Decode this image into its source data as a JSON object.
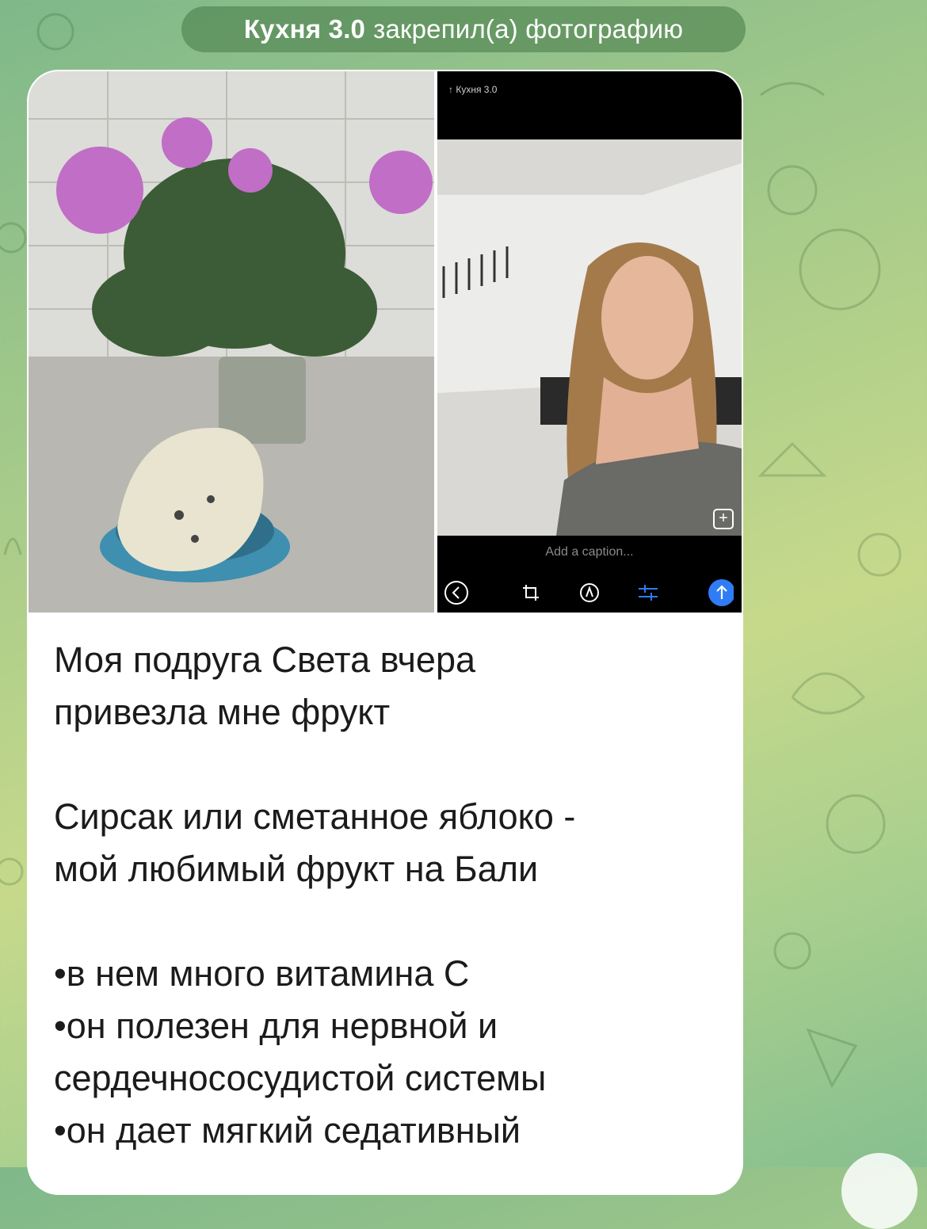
{
  "service_message": {
    "author": "Кухня 3.0",
    "action": "закрепил(а) фотографию"
  },
  "media": {
    "left_photo": {
      "subject": "fruit-and-flowers-photo"
    },
    "right_photo": {
      "subject": "selfie-screenshot",
      "header": "↑ Кухня 3.0",
      "caption_placeholder": "Add a caption...",
      "tools": [
        "back-icon",
        "crop-icon",
        "markup-icon",
        "adjust-icon",
        "send-icon"
      ]
    }
  },
  "post": {
    "paragraph1": "Моя подруга Света вчера\nпривезла мне фрукт",
    "paragraph2": "Сирсак или сметанное яблоко -\nмой любимый фрукт на Бали",
    "bullets": "•в нем много витамина С\n•он полезен для нервной и\nсердечнососудистой системы\n•он дает мягкий седативный"
  },
  "colors": {
    "accent": "#2f7cf6",
    "wallpaper_start": "#7fb88a",
    "wallpaper_end": "#c6d98b"
  }
}
